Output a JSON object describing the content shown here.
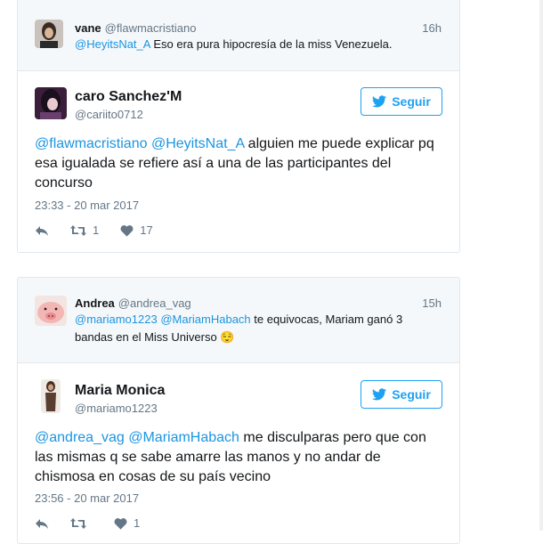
{
  "tweets": [
    {
      "reply": {
        "name": "vane",
        "handle": "@flawmacristiano",
        "time": "16h",
        "mention": "@HeyitsNat_A",
        "text": " Eso era pura hipocresía de la miss Venezuela."
      },
      "main": {
        "name": "caro Sanchez'M",
        "handle": "@cariito0712",
        "follow_label": "Seguir",
        "mention1": "@flawmacristiano",
        "mention2": "@HeyitsNat_A",
        "text": " alguien me puede explicar pq esa igualada se refiere así a una de las participantes del concurso",
        "date": "23:33 - 20 mar 2017",
        "retweets": "1",
        "likes": "17"
      }
    },
    {
      "reply": {
        "name": "Andrea",
        "handle": "@andrea_vag",
        "time": "15h",
        "mention1": "@mariamo1223",
        "mention2": "@MariamHabach",
        "text": " te equivocas, Mariam ganó 3 bandas en el Miss Universo ",
        "emoji": "😌"
      },
      "main": {
        "name": "Maria Monica",
        "handle": "@mariamo1223",
        "follow_label": "Seguir",
        "mention1": "@andrea_vag",
        "mention2": "@MariamHabach",
        "text": " me disculparas pero que con las mismas q se sabe amarre las manos y no andar de chismosa en cosas de su país vecino",
        "date": "23:56 - 20 mar 2017",
        "retweets": "",
        "likes": "1"
      }
    }
  ],
  "colors": {
    "accent": "#1da1f2",
    "link": "#1b95e0",
    "muted": "#657786",
    "border": "#e1e8ed",
    "reply_bg": "#f5f8fa"
  },
  "icons": [
    "reply-icon",
    "retweet-icon",
    "heart-icon",
    "twitter-bird-icon"
  ]
}
